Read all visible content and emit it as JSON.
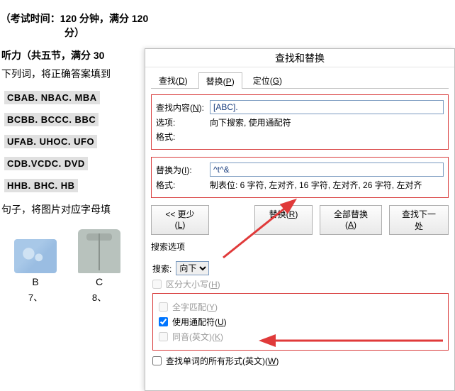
{
  "doc": {
    "subtitle": "（考试时间：120 分钟，满分 120 分）",
    "section1": "听力（共五节，满分 30",
    "instruction1": "下列词，将正确答案填到",
    "answers": [
      "CBAB. NBAC. MBA",
      "BCBB. BCCC. BBC",
      "UFAB. UHOC. UFO",
      "CDB.VCDC. DVD",
      "HHB. BHC. HB"
    ],
    "instruction2": "句子，将图片对应字母填",
    "img_labels": [
      "B",
      "C"
    ],
    "img_subs": [
      "7、",
      "8、"
    ]
  },
  "dialog": {
    "title": "查找和替换",
    "tabs": {
      "find": "查找(D)",
      "replace": "替换(P)",
      "goto": "定位(G)"
    },
    "find_label": "查找内容(N):",
    "find_value": "[ABC].",
    "options_label": "选项:",
    "options_value": "向下搜索, 使用通配符",
    "format1_label": "格式:",
    "replace_label": "替换为(I):",
    "replace_value": "^t^&",
    "format2_label": "格式:",
    "format2_value": "制表位:  6 字符, 左对齐,  16 字符, 左对齐,  26 字符, 左对齐",
    "btn_less": "<<  更少(L)",
    "btn_replace": "替换(R)",
    "btn_replace_all": "全部替换(A)",
    "btn_find_next": "查找下一处",
    "search_header": "搜索选项",
    "search_label": "搜索:",
    "direction": "向下",
    "cb_case": "区分大小写(H)",
    "cb_whole": "全字匹配(Y)",
    "cb_wildcard": "使用通配符(U)",
    "cb_homophone": "同音(英文)(K)",
    "cb_wordforms": "查找单词的所有形式(英文)(W)"
  }
}
